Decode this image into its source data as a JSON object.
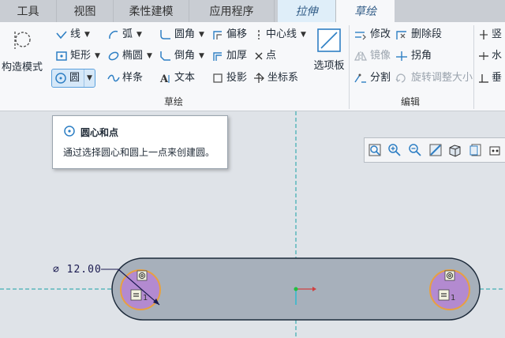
{
  "tabs": [
    {
      "label": "工具"
    },
    {
      "label": "视图"
    },
    {
      "label": "柔性建模"
    },
    {
      "label": "应用程序"
    },
    {
      "label": "拉伸"
    },
    {
      "label": "草绘"
    }
  ],
  "ribbon": {
    "groups": {
      "sketch": "草绘",
      "edit": "编辑"
    },
    "construction_mode": "构造模式",
    "line": "线",
    "arc": "弧",
    "fillet": "圆角",
    "offset": "偏移",
    "centerline": "中心线",
    "rectangle": "矩形",
    "ellipse": "椭圆",
    "chamfer": "倒角",
    "thicken": "加厚",
    "point": "点",
    "circle": "圆",
    "spline": "样条",
    "text": "文本",
    "project": "投影",
    "coordsys": "坐标系",
    "palette": "选项板",
    "modify": "修改",
    "delete_segment": "删除段",
    "mirror": "镜像",
    "corner": "拐角",
    "divide": "分割",
    "rotate_resize": "旋转调整大小",
    "vertical": "竖",
    "horizontal": "水",
    "perpendicular": "垂"
  },
  "tooltip": {
    "title": "圆心和点",
    "description": "通过选择圆心和圆上一点来创建圆。"
  },
  "sketch": {
    "dimension": "⌀ 12.00",
    "constraint_equal": "=",
    "constraint_concentric": "◎"
  },
  "colors": {
    "accent": "#2e7fc4",
    "slot_fill": "#a7b0bb",
    "circle_fill": "#b38ad0",
    "circle_ring": "#e8a040",
    "centerline": "#1aa0a6"
  }
}
